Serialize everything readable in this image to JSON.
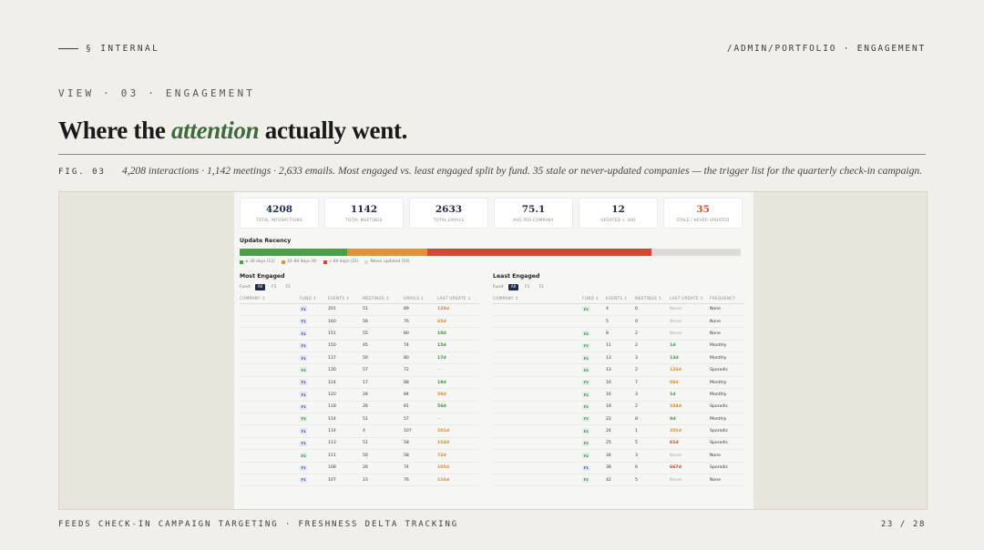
{
  "slide": {
    "section_tag": "§ INTERNAL",
    "path": "/ADMIN/PORTFOLIO · ENGAGEMENT",
    "view_label": "VIEW · 03 · ENGAGEMENT",
    "headline_pre": "Where the ",
    "headline_em": "attention",
    "headline_post": " actually went.",
    "fig_label": "FIG. 03",
    "fig_caption": "4,208 interactions · 1,142 meetings · 2,633 emails. Most engaged vs. least engaged split by fund. 35 stale or never-updated companies — the trigger list for the quarterly check-in campaign.",
    "footer_left": "FEEDS CHECK-IN CAMPAIGN TARGETING · FRESHNESS DELTA TRACKING",
    "page_number": "23 / 28"
  },
  "colors": {
    "background": "#f1efea",
    "accent_green": "#3d6b3b",
    "navy": "#1f2a44",
    "fresh": "#4f9d46",
    "mid": "#e0913a",
    "stale": "#cf4a35",
    "never": "#dedcd6"
  },
  "stats": [
    {
      "value": "4208",
      "label": "TOTAL INTERACTIONS",
      "alert": false
    },
    {
      "value": "1142",
      "label": "TOTAL MEETINGS",
      "alert": false
    },
    {
      "value": "2633",
      "label": "TOTAL EMAILS",
      "alert": false
    },
    {
      "value": "75.1",
      "label": "AVG PER COMPANY",
      "alert": false
    },
    {
      "value": "12",
      "label": "UPDATED < 30D",
      "alert": false
    },
    {
      "value": "35",
      "label": "STALE / NEVER UPDATED",
      "alert": true
    }
  ],
  "recency": {
    "title": "Update Recency",
    "segments": [
      {
        "key": "fresh",
        "label": "≤ 30 days (12)",
        "count": 12
      },
      {
        "key": "mid",
        "label": "30–60 days (9)",
        "count": 9
      },
      {
        "key": "stale",
        "label": "> 60 days (25)",
        "count": 25
      },
      {
        "key": "never",
        "label": "Never updated (10)",
        "count": 10
      }
    ]
  },
  "most_engaged": {
    "title": "Most Engaged",
    "fund_label": "Fund:",
    "filters": [
      "All",
      "F1",
      "F2"
    ],
    "columns": [
      "COMPANY ↕",
      "FUND ↕",
      "EVENTS ↕",
      "MEETINGS ↕",
      "EMAILS ↕",
      "LAST UPDATE ↕"
    ],
    "rows": [
      {
        "fund": "F1",
        "events": "201",
        "meetings": "51",
        "emails": "89",
        "update": "128d",
        "tone": "orange"
      },
      {
        "fund": "F1",
        "events": "160",
        "meetings": "56",
        "emails": "76",
        "update": "65d",
        "tone": "orange"
      },
      {
        "fund": "F1",
        "events": "151",
        "meetings": "55",
        "emails": "80",
        "update": "10d",
        "tone": "green"
      },
      {
        "fund": "F1",
        "events": "150",
        "meetings": "45",
        "emails": "74",
        "update": "15d",
        "tone": "green"
      },
      {
        "fund": "F1",
        "events": "137",
        "meetings": "50",
        "emails": "80",
        "update": "17d",
        "tone": "green"
      },
      {
        "fund": "F2",
        "events": "130",
        "meetings": "57",
        "emails": "72",
        "update": "—",
        "tone": "gray"
      },
      {
        "fund": "F1",
        "events": "124",
        "meetings": "17",
        "emails": "88",
        "update": "19d",
        "tone": "green"
      },
      {
        "fund": "F1",
        "events": "120",
        "meetings": "28",
        "emails": "84",
        "update": "59d",
        "tone": "orange"
      },
      {
        "fund": "F1",
        "events": "118",
        "meetings": "26",
        "emails": "81",
        "update": "56d",
        "tone": "green"
      },
      {
        "fund": "F2",
        "events": "114",
        "meetings": "51",
        "emails": "57",
        "update": "—",
        "tone": "gray"
      },
      {
        "fund": "F1",
        "events": "114",
        "meetings": "4",
        "emails": "107",
        "update": "201d",
        "tone": "orange"
      },
      {
        "fund": "F1",
        "events": "113",
        "meetings": "51",
        "emails": "58",
        "update": "154d",
        "tone": "orange"
      },
      {
        "fund": "F2",
        "events": "111",
        "meetings": "50",
        "emails": "58",
        "update": "72d",
        "tone": "orange"
      },
      {
        "fund": "F1",
        "events": "108",
        "meetings": "26",
        "emails": "74",
        "update": "105d",
        "tone": "orange"
      },
      {
        "fund": "F1",
        "events": "107",
        "meetings": "23",
        "emails": "76",
        "update": "116d",
        "tone": "orange"
      }
    ]
  },
  "least_engaged": {
    "title": "Least Engaged",
    "fund_label": "Fund:",
    "filters": [
      "All",
      "F1",
      "F2"
    ],
    "columns": [
      "COMPANY ↕",
      "FUND ↕",
      "EVENTS ↕",
      "MEETINGS ↕",
      "LAST UPDATE ↕",
      "FREQUENCY"
    ],
    "rows": [
      {
        "fund": "F2",
        "events": "4",
        "meetings": "0",
        "update": "Never",
        "tone": "gray",
        "freq": "None"
      },
      {
        "fund": "",
        "events": "5",
        "meetings": "0",
        "update": "Never",
        "tone": "gray",
        "freq": "None"
      },
      {
        "fund": "F2",
        "events": "8",
        "meetings": "2",
        "update": "Never",
        "tone": "gray",
        "freq": "None"
      },
      {
        "fund": "F2",
        "events": "11",
        "meetings": "2",
        "update": "1d",
        "tone": "green",
        "freq": "Monthly"
      },
      {
        "fund": "F2",
        "events": "13",
        "meetings": "3",
        "update": "13d",
        "tone": "green",
        "freq": "Monthly"
      },
      {
        "fund": "F2",
        "events": "13",
        "meetings": "2",
        "update": "126d",
        "tone": "orange",
        "freq": "Sporadic"
      },
      {
        "fund": "F2",
        "events": "16",
        "meetings": "7",
        "update": "98d",
        "tone": "orange",
        "freq": "Monthly"
      },
      {
        "fund": "F2",
        "events": "16",
        "meetings": "3",
        "update": "1d",
        "tone": "green",
        "freq": "Monthly"
      },
      {
        "fund": "F2",
        "events": "18",
        "meetings": "2",
        "update": "104d",
        "tone": "orange",
        "freq": "Sporadic"
      },
      {
        "fund": "F2",
        "events": "22",
        "meetings": "8",
        "update": "8d",
        "tone": "green",
        "freq": "Monthly"
      },
      {
        "fund": "F2",
        "events": "24",
        "meetings": "1",
        "update": "201d",
        "tone": "orange",
        "freq": "Sporadic"
      },
      {
        "fund": "F2",
        "events": "25",
        "meetings": "5",
        "update": "61d",
        "tone": "red",
        "freq": "Sporadic"
      },
      {
        "fund": "F2",
        "events": "34",
        "meetings": "3",
        "update": "Never",
        "tone": "gray",
        "freq": "None"
      },
      {
        "fund": "F1",
        "events": "38",
        "meetings": "6",
        "update": "667d",
        "tone": "red",
        "freq": "Sporadic"
      },
      {
        "fund": "F2",
        "events": "42",
        "meetings": "5",
        "update": "Never",
        "tone": "gray",
        "freq": "None"
      }
    ]
  }
}
